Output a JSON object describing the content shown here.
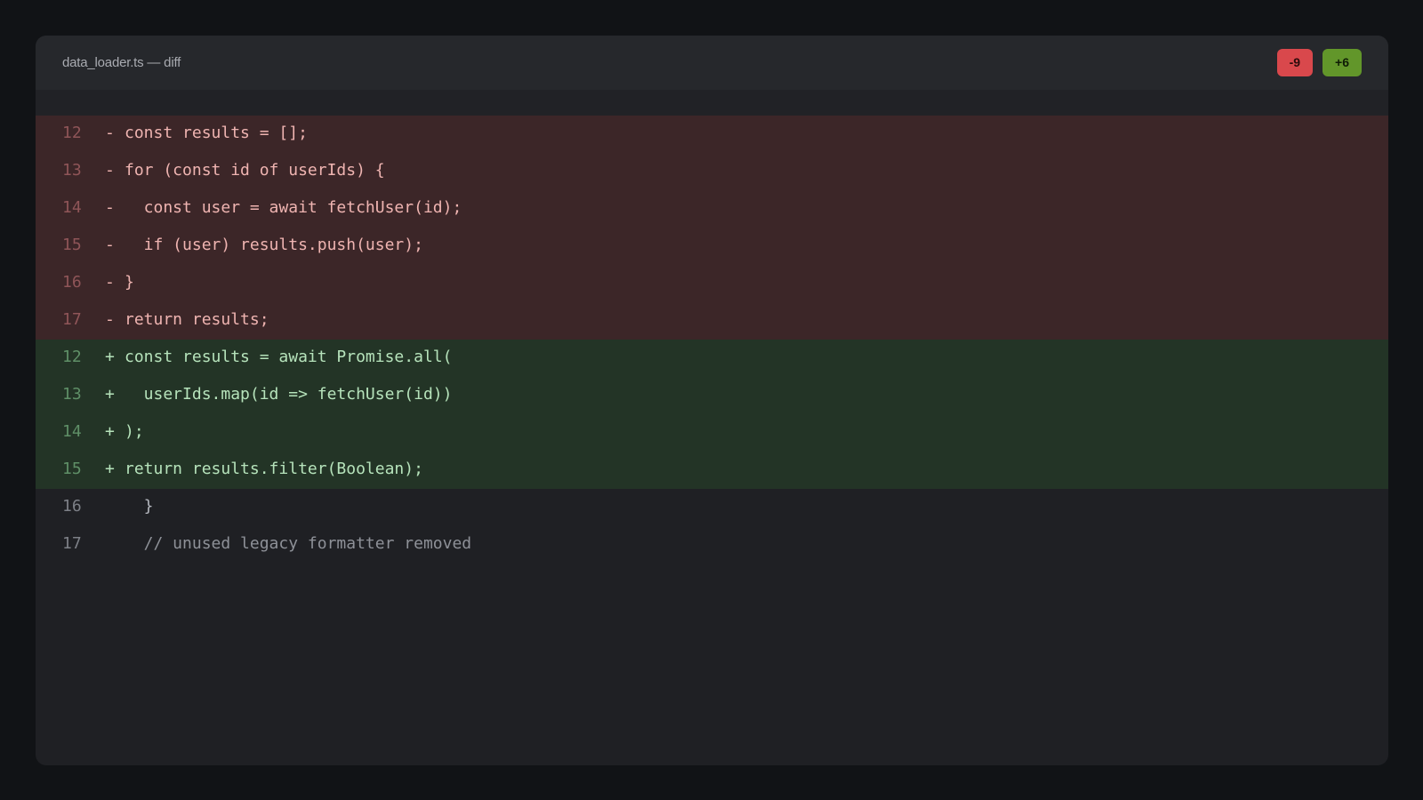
{
  "window": {
    "title": "data_loader.ts — diff"
  },
  "badges": {
    "removed": "-9",
    "added": "+6"
  },
  "colors": {
    "removed_badge": "#d9484c",
    "added_badge": "#62962a",
    "removed_line_bg": "#3c2628",
    "added_line_bg": "#233426"
  },
  "diff": {
    "lines": [
      {
        "type": "del",
        "num": "12",
        "marker": "-",
        "text": "const results = [];"
      },
      {
        "type": "del",
        "num": "13",
        "marker": "-",
        "text": "for (const id of userIds) {"
      },
      {
        "type": "del",
        "num": "14",
        "marker": "-",
        "text": "  const user = await fetchUser(id);"
      },
      {
        "type": "del",
        "num": "15",
        "marker": "-",
        "text": "  if (user) results.push(user);"
      },
      {
        "type": "del",
        "num": "16",
        "marker": "-",
        "text": "}"
      },
      {
        "type": "del",
        "num": "17",
        "marker": "-",
        "text": "return results;"
      },
      {
        "type": "add",
        "num": "12",
        "marker": "+",
        "text": "const results = await Promise.all("
      },
      {
        "type": "add",
        "num": "13",
        "marker": "+",
        "text": "  userIds.map(id => fetchUser(id))"
      },
      {
        "type": "add",
        "num": "14",
        "marker": "+",
        "text": ");"
      },
      {
        "type": "add",
        "num": "15",
        "marker": "+",
        "text": "return results.filter(Boolean);"
      },
      {
        "type": "ctx",
        "num": "16",
        "marker": "",
        "text": "  }"
      },
      {
        "type": "ctx",
        "num": "17",
        "marker": "",
        "text": "  // unused legacy formatter removed"
      }
    ]
  }
}
